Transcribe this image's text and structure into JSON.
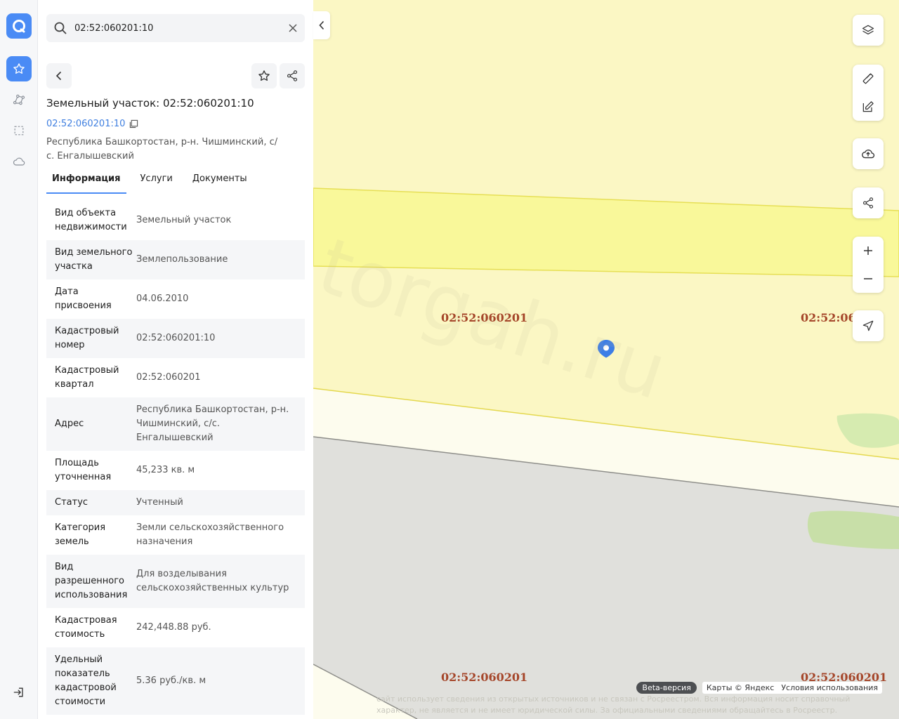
{
  "search": {
    "value": "02:52:060201:10"
  },
  "object": {
    "title": "Земельный участок: 02:52:060201:10",
    "cad_link": "02:52:060201:10",
    "address": "Республика Башкортостан, р-н. Чишминский, с/с. Енгалышевский"
  },
  "tabs": [
    "Информация",
    "Услуги",
    "Документы"
  ],
  "info_rows": [
    {
      "key": "Вид объекта недвижимости",
      "value": "Земельный участок"
    },
    {
      "key": "Вид земельного участка",
      "value": "Землепользование"
    },
    {
      "key": "Дата присвоения",
      "value": "04.06.2010"
    },
    {
      "key": "Кадастровый номер",
      "value": "02:52:060201:10"
    },
    {
      "key": "Кадастровый квартал",
      "value": "02:52:060201"
    },
    {
      "key": "Адрес",
      "value": "Республика Башкортостан, р-н. Чишминский, с/с. Енгалышевский"
    },
    {
      "key": "Площадь уточненная",
      "value": "45,233 кв. м"
    },
    {
      "key": "Статус",
      "value": "Учтенный"
    },
    {
      "key": "Категория земель",
      "value": "Земли сельскохозяйственного назначения"
    },
    {
      "key": "Вид разрешенного использования",
      "value": "Для возделывания сельскохозяйственных культур"
    },
    {
      "key": "Кадастровая стоимость",
      "value": "242,448.88 руб."
    },
    {
      "key": "Удельный показатель кадастровой стоимости",
      "value": "5.36 руб./кв. м"
    }
  ],
  "map": {
    "quarter_labels": [
      "02:52:060201",
      "02:52:06",
      "02:52:060201",
      "02:52:060201"
    ],
    "watermark": "torgah.ru",
    "beta": "Beta-версия",
    "copyright": "Карты © Яндекс",
    "terms": "Условия использования",
    "disclaimer": "сайт использует сведения из открытых источников и не связан с Росреестром. Вся информация носит справочный характер, не является и не имеет юридической силы. За официальными сведениями обращайтесь в Росреестр."
  },
  "colors": {
    "accent": "#4a8bf5",
    "parcel_fill": "#f9f7a3",
    "quarter_label": "#a5462a"
  }
}
